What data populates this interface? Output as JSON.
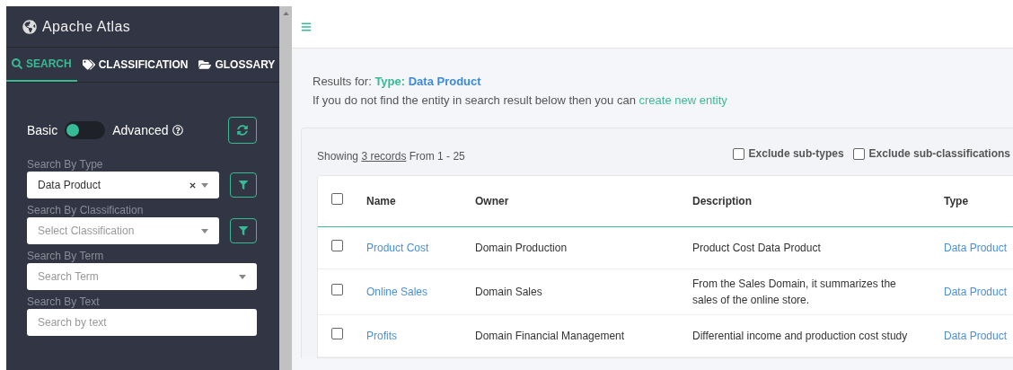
{
  "sidebar": {
    "title": "Apache Atlas",
    "tabs": [
      {
        "label": "SEARCH",
        "selected": true
      },
      {
        "label": "CLASSIFICATION",
        "selected": false
      },
      {
        "label": "GLOSSARY",
        "selected": false
      }
    ],
    "mode_toggle": {
      "left_label": "Basic",
      "right_label": "Advanced",
      "advanced": false
    },
    "fields": [
      {
        "label": "Search By Type",
        "kind": "select",
        "value": "Data Product"
      },
      {
        "label": "Search By Classification",
        "kind": "select",
        "placeholder": "Select Classification"
      },
      {
        "label": "Search By Term",
        "kind": "select",
        "placeholder": "Search Term"
      },
      {
        "label": "Search By Text",
        "kind": "text",
        "placeholder": "Search by text"
      }
    ]
  },
  "results": {
    "prefix": "Results for:",
    "type_label": "Type:",
    "type_value": "Data Product",
    "hint": "If you do not find the entity in search result below then you can",
    "hint_link": "create new entity",
    "showing": "Showing",
    "records_link": "3 records",
    "range": "From 1 - 25",
    "options": [
      {
        "label": "Exclude sub-types",
        "checked": false
      },
      {
        "label": "Exclude sub-classifications",
        "checked": false
      }
    ],
    "table": {
      "select_all": false,
      "columns": [
        "Name",
        "Owner",
        "Description",
        "Type"
      ],
      "rows": [
        {
          "checked": false,
          "name": "Product Cost",
          "owner": "Domain Production",
          "description": "Product Cost Data Product",
          "type": "Data Product"
        },
        {
          "checked": false,
          "name": "Online Sales",
          "owner": "Domain Sales",
          "description": "From the Sales Domain, it summarizes the sales of the online store.",
          "type": "Data Product"
        },
        {
          "checked": false,
          "name": "Profits",
          "owner": "Domain Financial Management",
          "description": "Differential income and production cost study",
          "type": "Data Product"
        }
      ]
    }
  }
}
